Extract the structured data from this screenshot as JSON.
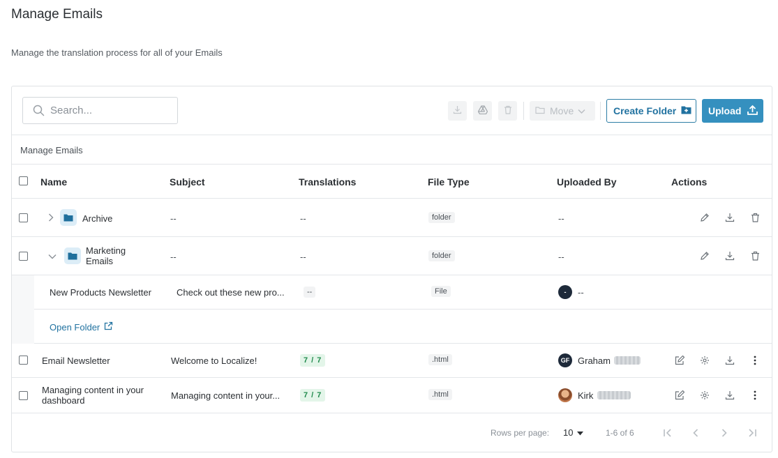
{
  "page": {
    "title": "Manage Emails",
    "subtitle": "Manage the translation process for all of your Emails"
  },
  "toolbar": {
    "search_placeholder": "Search...",
    "move_label": "Move",
    "create_folder_label": "Create Folder",
    "upload_label": "Upload"
  },
  "breadcrumb": "Manage Emails",
  "columns": [
    "Name",
    "Subject",
    "Translations",
    "File Type",
    "Uploaded By",
    "Actions"
  ],
  "rows": [
    {
      "name": "Archive",
      "subject": "--",
      "translations": "--",
      "file_type": "folder",
      "uploaded_by": "--"
    },
    {
      "name": "Marketing Emails",
      "subject": "--",
      "translations": "--",
      "file_type": "folder",
      "uploaded_by": "--"
    },
    {
      "name": "New Products Newsletter",
      "subject": "Check out these new pro...",
      "translations": "--",
      "file_type": "File",
      "avatar": "-",
      "uploaded_by": "--"
    },
    {
      "open_folder_label": "Open Folder"
    },
    {
      "name": "Email Newsletter",
      "subject": "Welcome to Localize!",
      "translations": "7 / 7",
      "file_type": ".html",
      "avatar": "GF",
      "uploaded_by": "Graham"
    },
    {
      "name": "Managing content in your dashboard",
      "subject": "Managing content in your...",
      "translations": "7 / 7",
      "file_type": ".html",
      "uploaded_by": "Kirk"
    }
  ],
  "footer": {
    "rows_per_page_label": "Rows per page:",
    "rows_per_page_value": "10",
    "range_label": "1-6 of 6"
  },
  "colors": {
    "primary": "#3590bf",
    "link": "#2172a0",
    "success": "#1f8a4c"
  },
  "icons": [
    "search-icon",
    "download-icon",
    "drive-icon",
    "trash-icon",
    "folder-icon",
    "chevron-down-icon",
    "folder-plus-icon",
    "upload-icon",
    "chevron-right-icon",
    "pencil-icon",
    "edit-icon",
    "gear-icon",
    "more-vertical-icon",
    "external-link-icon",
    "first-page-icon",
    "prev-page-icon",
    "next-page-icon",
    "last-page-icon"
  ]
}
